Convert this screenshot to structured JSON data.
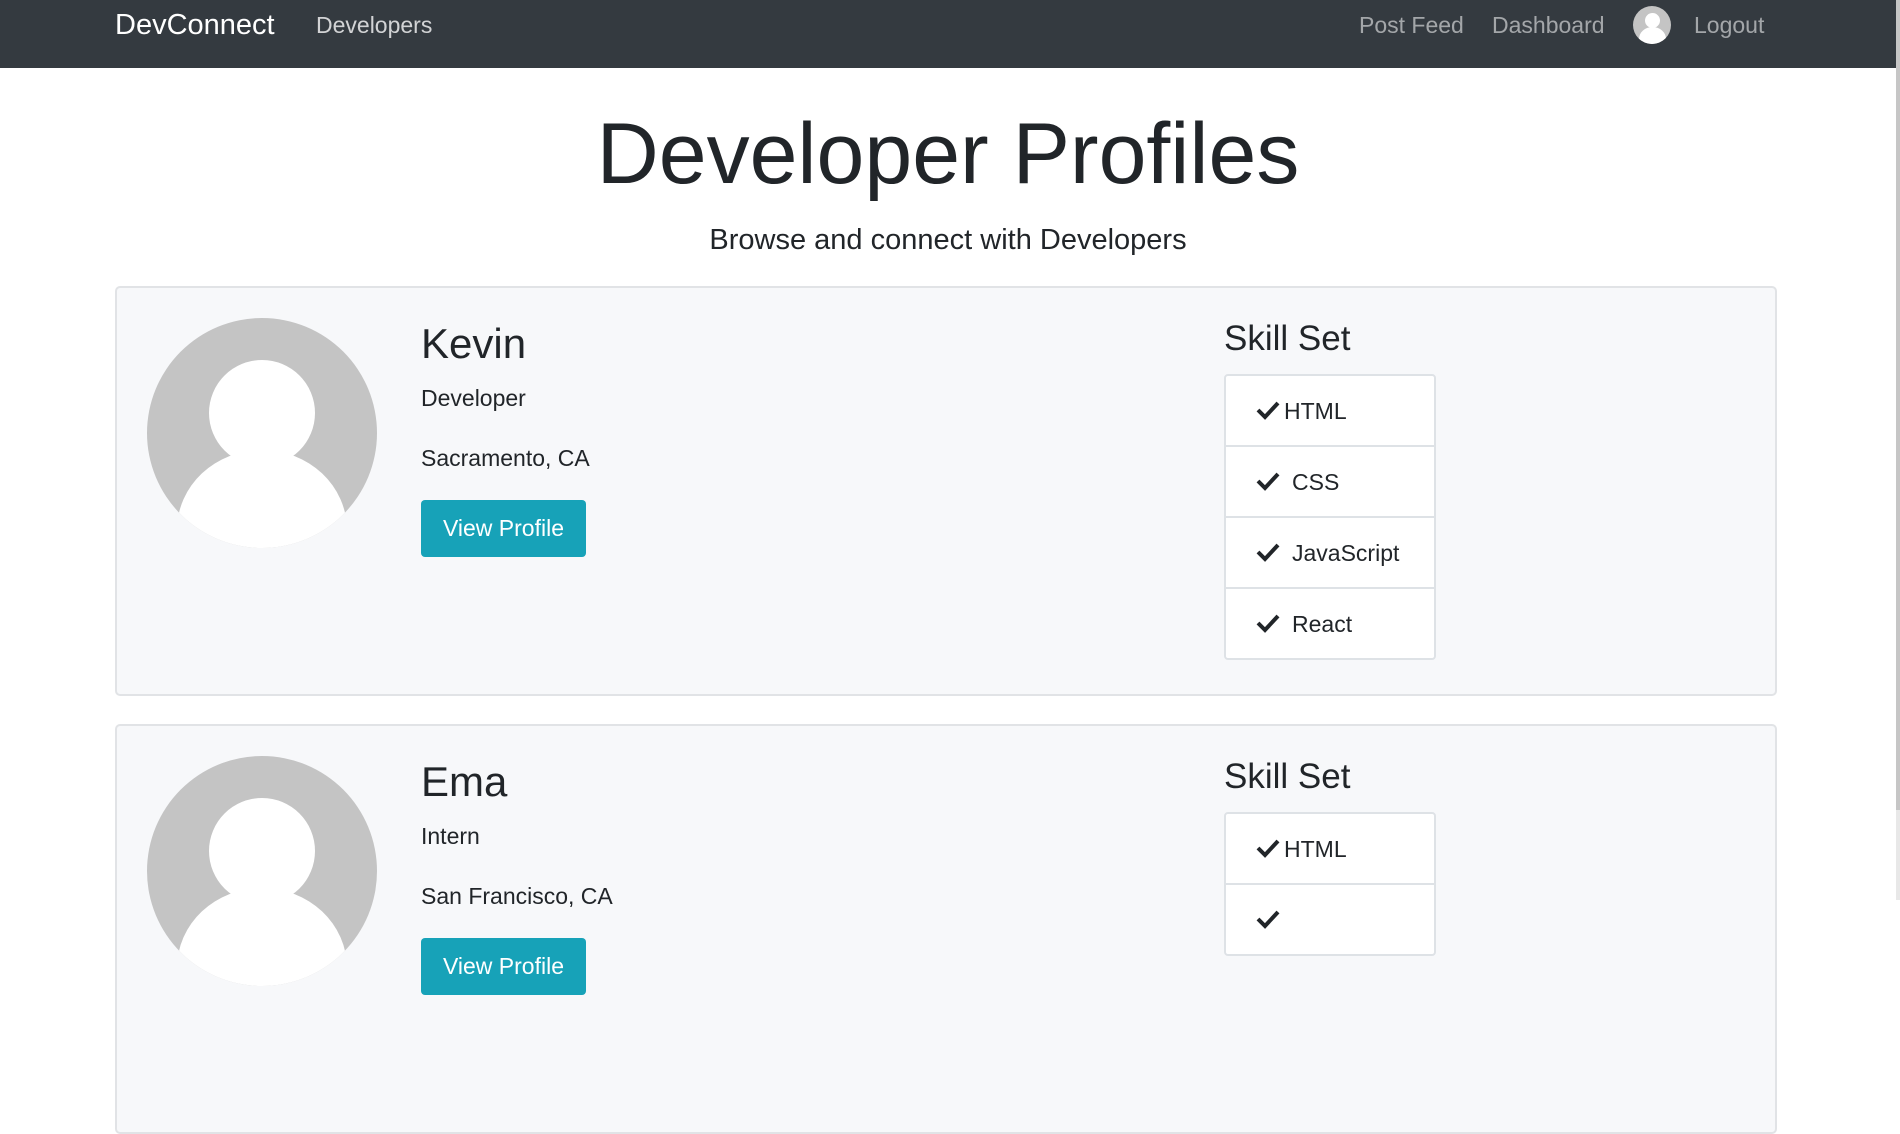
{
  "navbar": {
    "brand": "DevConnect",
    "links": {
      "developers": "Developers",
      "post_feed": "Post Feed",
      "dashboard": "Dashboard",
      "logout": "Logout"
    },
    "avatar_icon": "user-avatar-icon"
  },
  "header": {
    "title": "Developer Profiles",
    "subtitle": "Browse and connect with Developers"
  },
  "profiles": [
    {
      "name": "Kevin",
      "status": "Developer",
      "location": "Sacramento, CA",
      "button_label": "View Profile",
      "skills_title": "Skill Set",
      "skills": [
        "HTML",
        "CSS",
        "JavaScript",
        "React"
      ]
    },
    {
      "name": "Ema",
      "status": "Intern",
      "location": "San Francisco, CA",
      "button_label": "View Profile",
      "skills_title": "Skill Set",
      "skills": [
        "HTML",
        "",
        "",
        ""
      ]
    }
  ],
  "colors": {
    "navbar_bg": "#343a40",
    "button_bg": "#17a2b8",
    "card_bg": "#f7f8fa",
    "avatar_gray": "#c4c4c4"
  }
}
